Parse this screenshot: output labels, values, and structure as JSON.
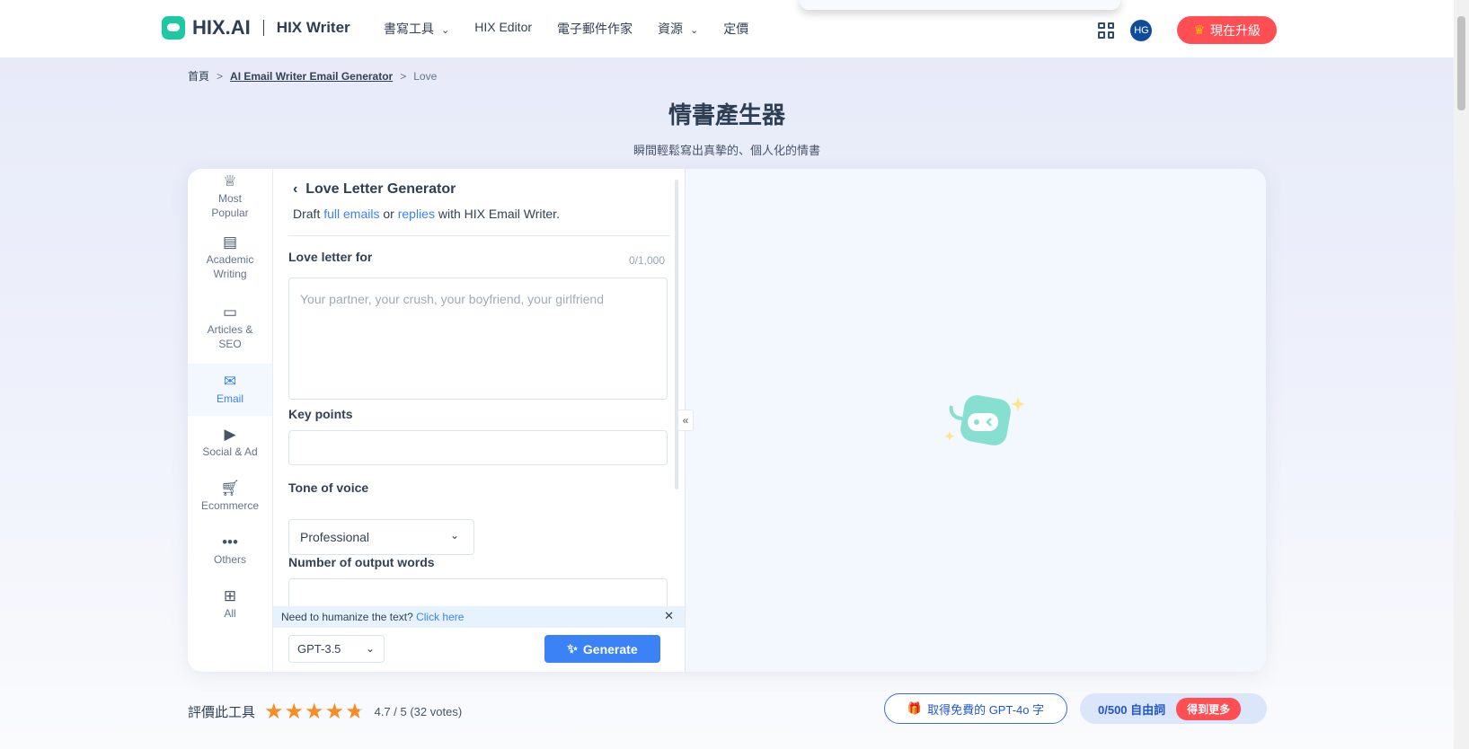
{
  "header": {
    "logo": "HIX.AI",
    "product": "HIX Writer",
    "nav": [
      {
        "label": "書寫工具",
        "dropdown": true
      },
      {
        "label": "HIX Editor",
        "dropdown": false
      },
      {
        "label": "電子郵件作家",
        "dropdown": false
      },
      {
        "label": "資源",
        "dropdown": true
      },
      {
        "label": "定價",
        "dropdown": false
      }
    ],
    "avatar": "HG",
    "upgrade": "現在升級"
  },
  "breadcrumb": {
    "home": "首頁",
    "parent": "AI Email Writer Email Generator",
    "current": "Love"
  },
  "page": {
    "title": "情書產生器",
    "subtitle": "瞬間輕鬆寫出真摯的、個人化的情書"
  },
  "sidebar": {
    "items": [
      {
        "icon": "crown-icon",
        "line1": "Most",
        "line2": "Popular"
      },
      {
        "icon": "newspaper-icon",
        "line1": "Academic",
        "line2": "Writing"
      },
      {
        "icon": "browser-icon",
        "line1": "Articles &",
        "line2": "SEO"
      },
      {
        "icon": "mail-icon",
        "line1": "Email",
        "line2": "",
        "active": true
      },
      {
        "icon": "monitor-play-icon",
        "line1": "Social & Ad",
        "line2": ""
      },
      {
        "icon": "cart-icon",
        "line1": "Ecommerce",
        "line2": ""
      },
      {
        "icon": "more-icon",
        "line1": "Others",
        "line2": ""
      },
      {
        "icon": "grid-icon",
        "line1": "All",
        "line2": ""
      }
    ]
  },
  "form": {
    "title": "Love Letter Generator",
    "desc_pre": "Draft ",
    "desc_link1": "full emails",
    "desc_mid": " or ",
    "desc_link2": "replies",
    "desc_post": " with HIX Email Writer.",
    "field1_label": "Love letter for",
    "field1_count": "0/1,000",
    "field1_placeholder": "Your partner, your crush, your boyfriend, your girlfriend",
    "field2_label": "Key points",
    "field2_value": "",
    "field3_label": "Tone of voice",
    "field3_value": "Professional",
    "field4_label": "Number of output words",
    "notice_text": "Need to humanize the text? ",
    "notice_link": "Click here",
    "model": "GPT-3.5",
    "generate": "Generate"
  },
  "footer": {
    "rate_label": "評價此工具",
    "rating": 4.7,
    "rating_text": "4.7 / 5 (32 votes)",
    "gpt4_offer": "取得免費的 GPT-4o 字",
    "credits": "0/500 自由詞",
    "more": "得到更多"
  },
  "colors": {
    "accent": "#3b82f6",
    "upgrade": "#ff4f55",
    "brand": "#1fc8a5",
    "star": "#fb8c24"
  }
}
